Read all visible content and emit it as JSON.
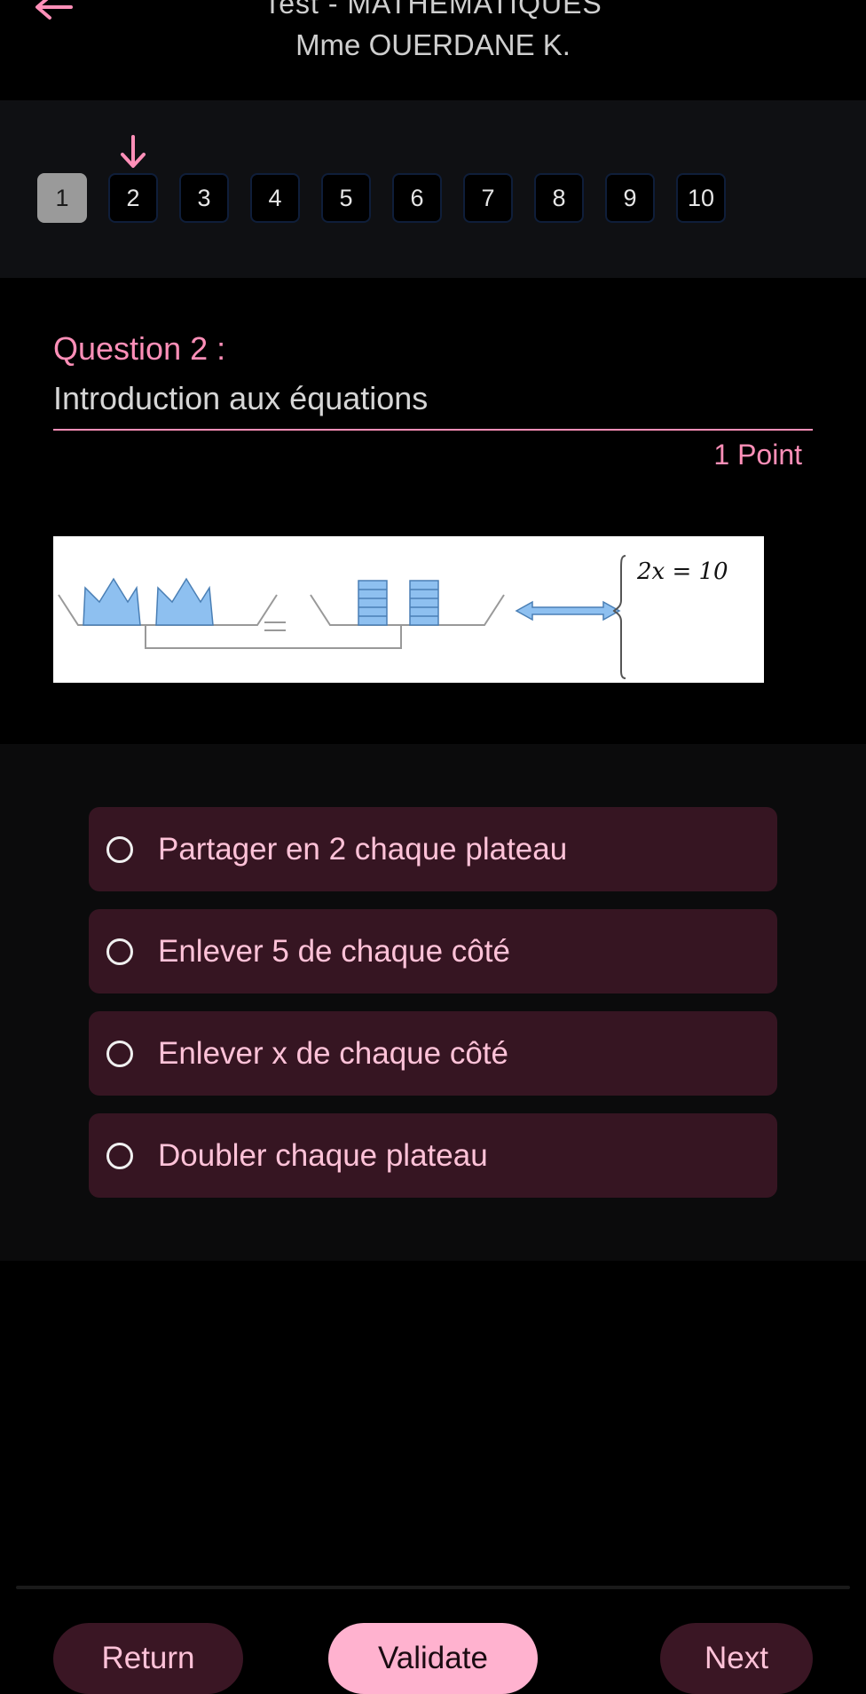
{
  "header": {
    "title": "Test - MATHEMATIQUES",
    "subtitle": "Mme OUERDANE K.",
    "back_icon": "arrow-left-icon"
  },
  "nav": {
    "current": 2,
    "marker_icon": "arrow-down-icon",
    "questions": [
      "1",
      "2",
      "3",
      "4",
      "5",
      "6",
      "7",
      "8",
      "9",
      "10"
    ]
  },
  "question": {
    "label": "Question 2 :",
    "title": "Introduction aux équations",
    "points": "1 Point",
    "image_equation": "2x = 10"
  },
  "answers": [
    {
      "label": "Partager en 2 chaque plateau"
    },
    {
      "label": "Enlever 5 de chaque côté"
    },
    {
      "label": "Enlever x de chaque côté"
    },
    {
      "label": "Doubler chaque plateau"
    }
  ],
  "footer": {
    "return_label": "Return",
    "validate_label": "Validate",
    "next_label": "Next"
  },
  "colors": {
    "accent": "#ff8fb8",
    "option_bg": "#361522",
    "validate_bg": "#ffb2cf"
  }
}
